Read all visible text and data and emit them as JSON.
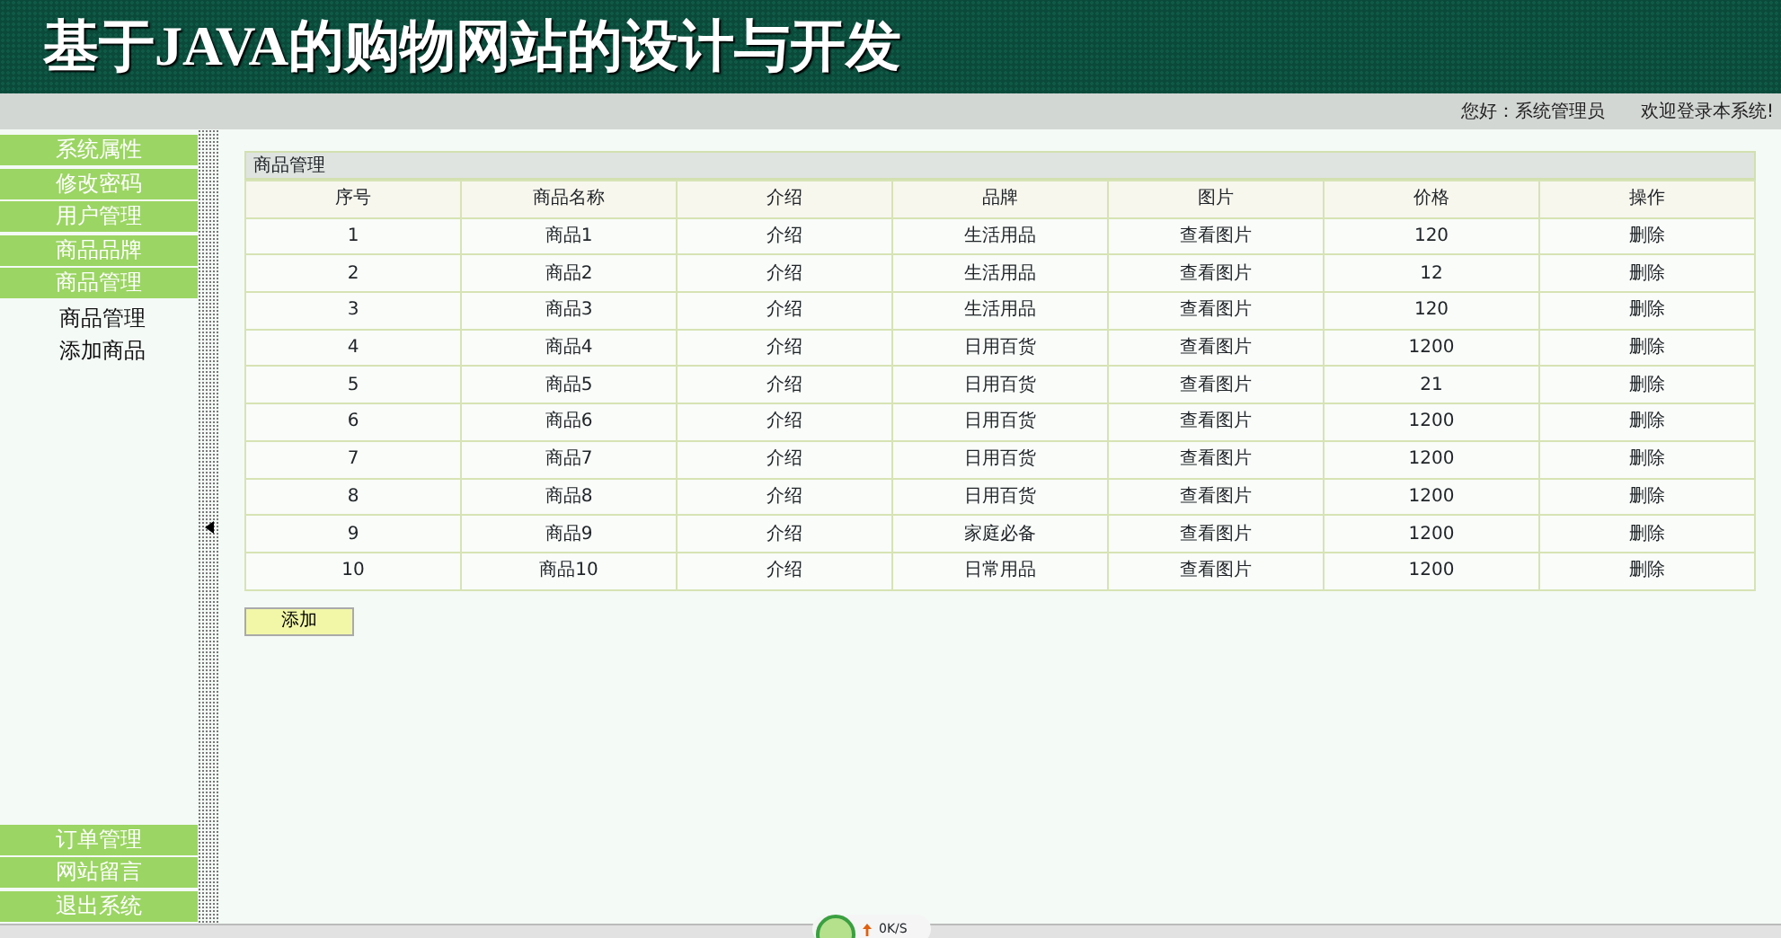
{
  "header": {
    "title": "基于JAVA的购物网站的设计与开发"
  },
  "info_bar": {
    "greeting": "您好：系统管理员",
    "welcome": "欢迎登录本系统!"
  },
  "sidebar": {
    "top_items": [
      {
        "label": "系统属性"
      },
      {
        "label": "修改密码"
      },
      {
        "label": "用户管理"
      },
      {
        "label": "商品品牌"
      },
      {
        "label": "商品管理",
        "children": [
          {
            "label": "商品管理"
          },
          {
            "label": "添加商品"
          }
        ]
      }
    ],
    "bottom_items": [
      {
        "label": "订单管理"
      },
      {
        "label": "网站留言"
      },
      {
        "label": "退出系统"
      }
    ]
  },
  "panel": {
    "title": "商品管理",
    "table": {
      "columns": [
        "序号",
        "商品名称",
        "介绍",
        "品牌",
        "图片",
        "价格",
        "操作"
      ],
      "rows": [
        [
          "1",
          "商品1",
          "介绍",
          "生活用品",
          "查看图片",
          "120",
          "删除"
        ],
        [
          "2",
          "商品2",
          "介绍",
          "生活用品",
          "查看图片",
          "12",
          "删除"
        ],
        [
          "3",
          "商品3",
          "介绍",
          "生活用品",
          "查看图片",
          "120",
          "删除"
        ],
        [
          "4",
          "商品4",
          "介绍",
          "日用百货",
          "查看图片",
          "1200",
          "删除"
        ],
        [
          "5",
          "商品5",
          "介绍",
          "日用百货",
          "查看图片",
          "21",
          "删除"
        ],
        [
          "6",
          "商品6",
          "介绍",
          "日用百货",
          "查看图片",
          "1200",
          "删除"
        ],
        [
          "7",
          "商品7",
          "介绍",
          "日用百货",
          "查看图片",
          "1200",
          "删除"
        ],
        [
          "8",
          "商品8",
          "介绍",
          "日用百货",
          "查看图片",
          "1200",
          "删除"
        ],
        [
          "9",
          "商品9",
          "介绍",
          "家庭必备",
          "查看图片",
          "1200",
          "删除"
        ],
        [
          "10",
          "商品10",
          "介绍",
          "日常用品",
          "查看图片",
          "1200",
          "删除"
        ]
      ]
    },
    "add_button": "添加"
  },
  "speed_widget": {
    "reading": "0K/S"
  }
}
